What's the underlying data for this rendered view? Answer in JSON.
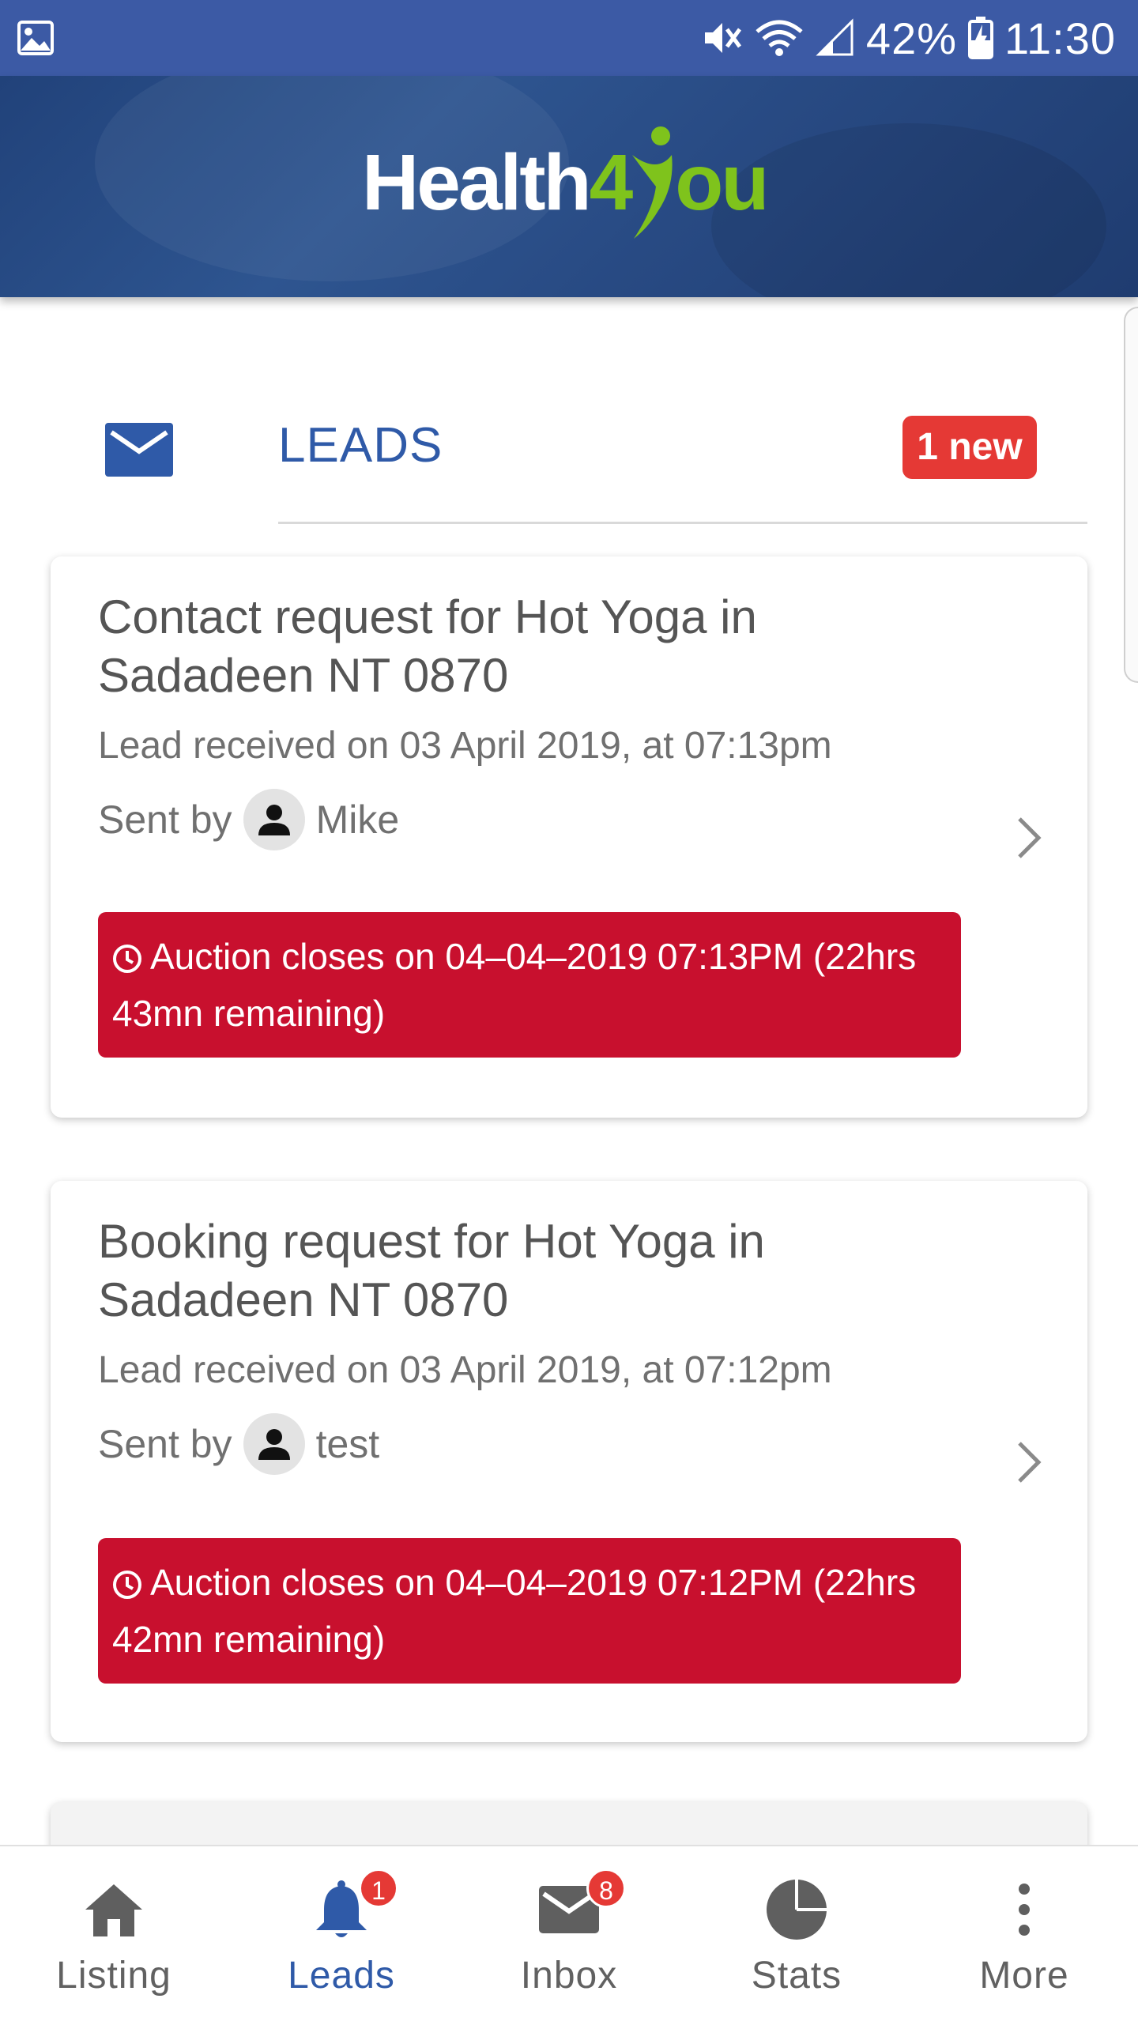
{
  "status_bar": {
    "battery": "42%",
    "time": "11:30"
  },
  "header": {
    "logo_left": "Health",
    "logo_four": "4",
    "logo_right": "ou"
  },
  "leads": {
    "title": "LEADS",
    "new_badge": "1 new"
  },
  "cards": [
    {
      "title": "Contact request for Hot Yoga in Sadadeen NT 0870",
      "received": "Lead received on 03 April 2019, at 07:13pm",
      "sent_by_label": "Sent by",
      "sender": "Mike",
      "auction": "Auction closes on 04–04–2019 07:13PM (22hrs 43mn remaining)"
    },
    {
      "title": "Booking request for Hot Yoga in Sadadeen NT 0870",
      "received": "Lead received on 03 April 2019, at 07:12pm",
      "sent_by_label": "Sent by",
      "sender": "test",
      "auction": "Auction closes on 04–04–2019 07:12PM (22hrs 42mn remaining)"
    }
  ],
  "bottom_nav": [
    {
      "label": "Listing",
      "icon": "home-icon"
    },
    {
      "label": "Leads",
      "icon": "bell-icon",
      "badge": "1",
      "active": true
    },
    {
      "label": "Inbox",
      "icon": "envelope-icon",
      "badge": "8"
    },
    {
      "label": "Stats",
      "icon": "pie-chart-icon"
    },
    {
      "label": "More",
      "icon": "more-vertical-icon"
    }
  ],
  "colors": {
    "brand_blue": "#2f5aa8",
    "status_blue": "#3c5aa5",
    "alert_red": "#c8102e",
    "badge_red": "#e53935",
    "logo_green": "#7fc31c"
  }
}
